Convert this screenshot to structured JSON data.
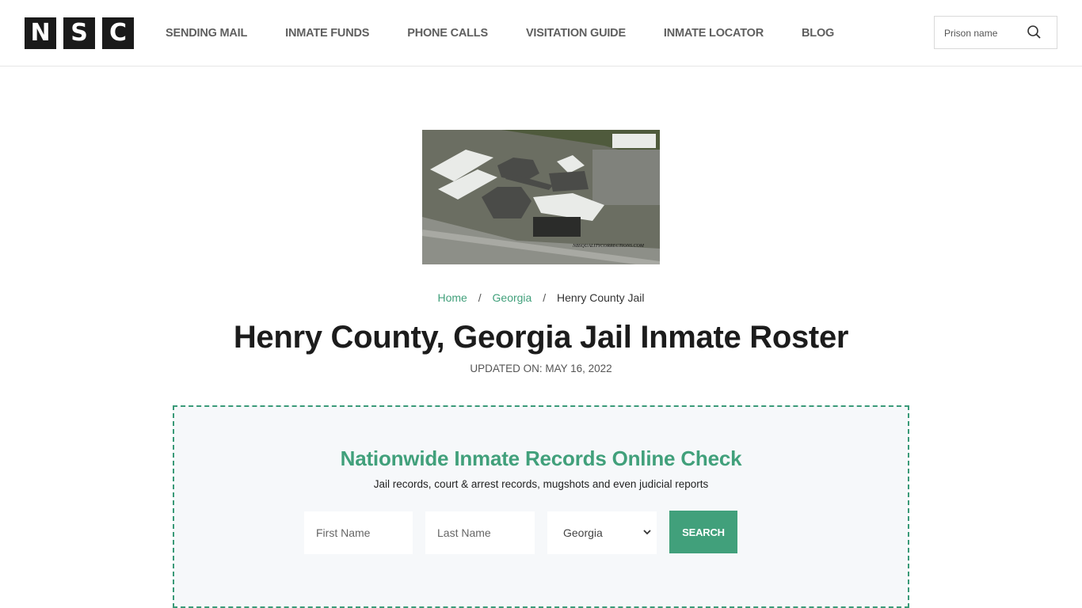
{
  "header": {
    "logo_letters": [
      "N",
      "S",
      "C"
    ],
    "nav": [
      {
        "label": "SENDING MAIL"
      },
      {
        "label": "INMATE FUNDS"
      },
      {
        "label": "PHONE CALLS"
      },
      {
        "label": "VISITATION GUIDE"
      },
      {
        "label": "INMATE LOCATOR"
      },
      {
        "label": "BLOG"
      }
    ],
    "search": {
      "placeholder": "Prison name",
      "value": "",
      "icon": "search-icon"
    }
  },
  "hero": {
    "image_alt": "Henry County Jail aerial view",
    "image_watermark": "NBSQUALITYCORRECTIONS.COM"
  },
  "breadcrumb": {
    "items": [
      {
        "label": "Home",
        "link": true
      },
      {
        "label": "Georgia",
        "link": true
      },
      {
        "label": "Henry County Jail",
        "link": false
      }
    ],
    "separator": "/"
  },
  "page": {
    "title": "Henry County, Georgia Jail Inmate Roster",
    "updated": "UPDATED ON: MAY 16, 2022"
  },
  "records_check": {
    "title": "Nationwide Inmate Records Online Check",
    "subtitle": "Jail records, court & arrest records, mugshots and even judicial reports",
    "first_name": {
      "placeholder": "First Name",
      "value": ""
    },
    "last_name": {
      "placeholder": "Last Name",
      "value": ""
    },
    "state": {
      "selected": "Georgia",
      "icon": "chevron-down-icon"
    },
    "search_label": "SEARCH"
  },
  "colors": {
    "accent": "#41a07b",
    "logo_bg": "#1a1a1a",
    "nav_text": "#5f5f5f",
    "panel_bg": "#f6f8fa"
  }
}
